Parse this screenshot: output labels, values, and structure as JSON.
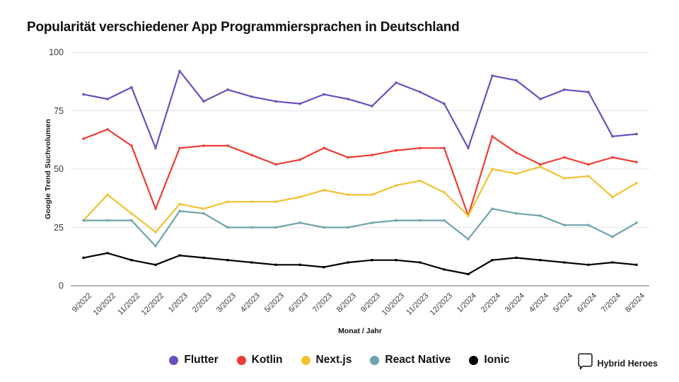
{
  "chart_data": {
    "type": "line",
    "title": "Popularität verschiedener App Programmiersprachen in Deutschland",
    "xlabel": "Monat / Jahr",
    "ylabel": "Google Trend Suchvolumen",
    "ylim": [
      0,
      100
    ],
    "yticks": [
      0,
      25,
      50,
      75,
      100
    ],
    "grid": true,
    "legend_position": "bottom",
    "categories": [
      "9/2022",
      "10/2022",
      "11/2022",
      "12/2022",
      "1/2023",
      "2/2023",
      "3/2023",
      "4/2023",
      "5/2023",
      "6/2023",
      "7/2023",
      "8/2023",
      "9/2023",
      "10/2023",
      "11/2023",
      "12/2023",
      "1/2024",
      "2/2024",
      "3/2024",
      "4/2024",
      "5/2024",
      "6/2024",
      "7/2024",
      "8/2024"
    ],
    "series": [
      {
        "name": "Flutter",
        "color": "#6B4EC0",
        "values": [
          82,
          80,
          85,
          59,
          92,
          79,
          84,
          81,
          79,
          78,
          82,
          80,
          79,
          77,
          87,
          83,
          78,
          59,
          90,
          88,
          80,
          84,
          83,
          64,
          64,
          65
        ]
      },
      {
        "name": "Kotlin",
        "color": "#EE3C34",
        "values": [
          63,
          67,
          60,
          33,
          59,
          60,
          60,
          56,
          52,
          54,
          59,
          55,
          56,
          58,
          59,
          59,
          59,
          30,
          64,
          57,
          55,
          52,
          55,
          52,
          55,
          53
        ]
      },
      {
        "name": "Next.js",
        "color": "#F2C230",
        "values": [
          28,
          39,
          31,
          23,
          35,
          33,
          36,
          36,
          36,
          38,
          41,
          39,
          39,
          43,
          45,
          40,
          35,
          30,
          50,
          48,
          51,
          46,
          47,
          38,
          44,
          46
        ]
      },
      {
        "name": "React Native",
        "color": "#6FA3AE",
        "values": [
          28,
          28,
          28,
          17,
          32,
          31,
          25,
          25,
          25,
          27,
          25,
          25,
          27,
          27,
          28,
          28,
          28,
          20,
          33,
          31,
          30,
          26,
          26,
          21,
          27,
          23
        ]
      },
      {
        "name": "Ionic",
        "color": "#000000",
        "values": [
          12,
          14,
          11,
          9,
          13,
          12,
          11,
          10,
          9,
          9,
          8,
          10,
          11,
          11,
          10,
          7,
          5,
          11,
          12,
          11,
          10,
          9,
          10,
          9,
          10
        ]
      }
    ],
    "series_aligned": {
      "Flutter": [
        82,
        80,
        85,
        59,
        92,
        79,
        84,
        81,
        79,
        78,
        82,
        80,
        77,
        87,
        83,
        78,
        59,
        90,
        88,
        80,
        84,
        83,
        64,
        65
      ],
      "Kotlin": [
        63,
        67,
        60,
        33,
        59,
        60,
        60,
        56,
        52,
        54,
        59,
        55,
        56,
        58,
        59,
        59,
        30,
        64,
        57,
        52,
        55,
        52,
        55,
        53
      ],
      "Next.js": [
        28,
        39,
        31,
        23,
        35,
        33,
        36,
        36,
        36,
        38,
        41,
        39,
        39,
        43,
        45,
        40,
        30,
        50,
        48,
        51,
        46,
        47,
        38,
        44
      ],
      "React Native": [
        28,
        28,
        28,
        17,
        32,
        31,
        25,
        25,
        25,
        27,
        25,
        25,
        27,
        28,
        28,
        28,
        20,
        33,
        31,
        30,
        26,
        26,
        21,
        27
      ],
      "Ionic": [
        12,
        14,
        11,
        9,
        13,
        12,
        11,
        10,
        9,
        9,
        8,
        10,
        11,
        11,
        10,
        7,
        5,
        11,
        12,
        11,
        10,
        9,
        10,
        9
      ]
    }
  },
  "legend": {
    "items": [
      {
        "label": "Flutter",
        "color": "#6B4EC0"
      },
      {
        "label": "Kotlin",
        "color": "#EE3C34"
      },
      {
        "label": "Next.js",
        "color": "#F2C230"
      },
      {
        "label": "React Native",
        "color": "#6FA3AE"
      },
      {
        "label": "Ionic",
        "color": "#000000"
      }
    ]
  },
  "brand": {
    "name": "Hybrid Heroes"
  },
  "axis": {
    "gridline_color": "#E6E6E6",
    "baseline_color": "#9A9A9A"
  }
}
